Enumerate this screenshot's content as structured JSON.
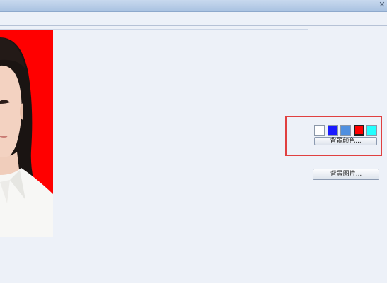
{
  "window": {
    "close_glyph": "✕"
  },
  "background_colors": {
    "swatches": [
      {
        "name": "white",
        "color": "#ffffff",
        "selected": false
      },
      {
        "name": "blue",
        "color": "#1a1aff",
        "selected": false
      },
      {
        "name": "light-blue",
        "color": "#4f8fe0",
        "selected": false
      },
      {
        "name": "red",
        "color": "#ff0000",
        "selected": true
      },
      {
        "name": "cyan",
        "color": "#22ffff",
        "selected": false
      }
    ],
    "button_label": "背景颜色..."
  },
  "background_image": {
    "button_label": "背景图片..."
  },
  "photo": {
    "background_color": "#ff0000"
  },
  "highlight_color": "#e04040"
}
